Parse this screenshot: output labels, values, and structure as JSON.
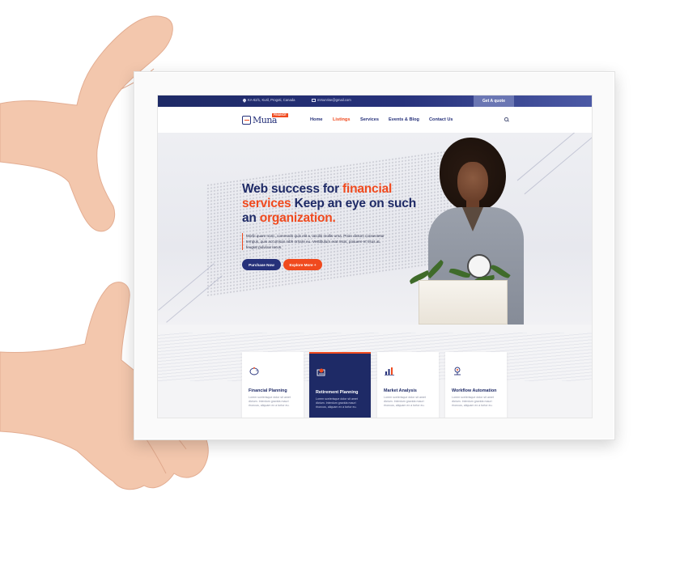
{
  "topbar": {
    "address": "KA-62/1, Kuril, Progoti, Canada",
    "email": "mrsunrise@gmail.com",
    "quote_button": "Get A quote"
  },
  "header": {
    "logo_text": "Muna",
    "logo_badge": "FINANCE",
    "nav": [
      "Home",
      "Listings",
      "Services",
      "Events & Blog",
      "Contact Us"
    ],
    "active_nav": "Listings"
  },
  "hero": {
    "title_part1": "Web success for ",
    "title_hl1": "financial services",
    "title_part2": " Keep an eye on such an ",
    "title_hl2": "organization.",
    "body": "Morbi quam nunc, commodo quis elit a, iaculis mollis urna. Proin dictum consectetur tempus, quis accumsan nibh ornare eu. Vestibulum erat risus, posuere et risus at, feugiat pulvinar lacus.",
    "btn_purchase": "Purchase Now",
    "btn_explore": "Explore More +"
  },
  "services": [
    {
      "title": "Financial Planning",
      "text": "Lorem scelerisque dolor sit amet dictum. Interdum gravida mauri rhoncus, aliquam ex a tortor eu."
    },
    {
      "title": "Retirement Planning",
      "text": "Lorem scelerisque dolor sit amet dictum. Interdum gravida mauri rhoncus, aliquam ex a tortor eu."
    },
    {
      "title": "Market Analysis",
      "text": "Lorem scelerisque dolor sit amet dictum. Interdum gravida mauri rhoncus, aliquam ex a tortor eu."
    },
    {
      "title": "Workflow Automation",
      "text": "Lorem scelerisque dolor sit amet dictum. Interdum gravida mauri rhoncus, aliquam ex a tortor eu."
    }
  ],
  "icons": {
    "card1": "piggy-bank-icon",
    "card2": "retirement-icon",
    "card3": "market-analysis-icon",
    "card4": "workflow-icon"
  },
  "colors": {
    "navy": "#1e2a66",
    "accent": "#f04a1e",
    "frame": "#fafafa",
    "skin": "#f2c4a8"
  }
}
